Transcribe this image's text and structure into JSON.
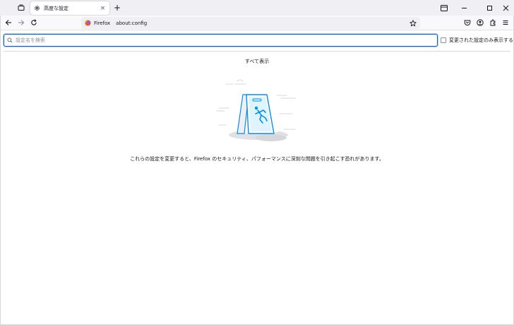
{
  "tabbar": {
    "tab": {
      "title": "高度な設定",
      "close_glyph": "×"
    },
    "new_tab_glyph": "+"
  },
  "navbar": {
    "identity_label": "Firefox",
    "url": "about:config"
  },
  "content": {
    "search_placeholder": "設定名を検索",
    "modified_only_label": "変更された設定のみ表示する",
    "show_all": "すべて表示",
    "warning": "これらの設定を変更すると、Firefox のセキュリティ、パフォーマンスに深刻な問題を引き起こす恐れがあります。"
  },
  "colors": {
    "accent": "#0061e0",
    "illustration_blue": "#0090ed",
    "tabbar_bg": "#f0f0f4",
    "navbar_bg": "#f9f9fb"
  },
  "icons": [
    "tabs-list-icon",
    "settings-gear-icon",
    "close-icon",
    "plus-icon",
    "window-tabs-icon",
    "minimize-icon",
    "maximize-icon",
    "window-close-icon",
    "back-arrow-icon",
    "forward-arrow-icon",
    "reload-icon",
    "firefox-logo-icon",
    "bookmark-star-icon",
    "pocket-icon",
    "account-icon",
    "extensions-icon",
    "menu-icon",
    "search-icon"
  ]
}
